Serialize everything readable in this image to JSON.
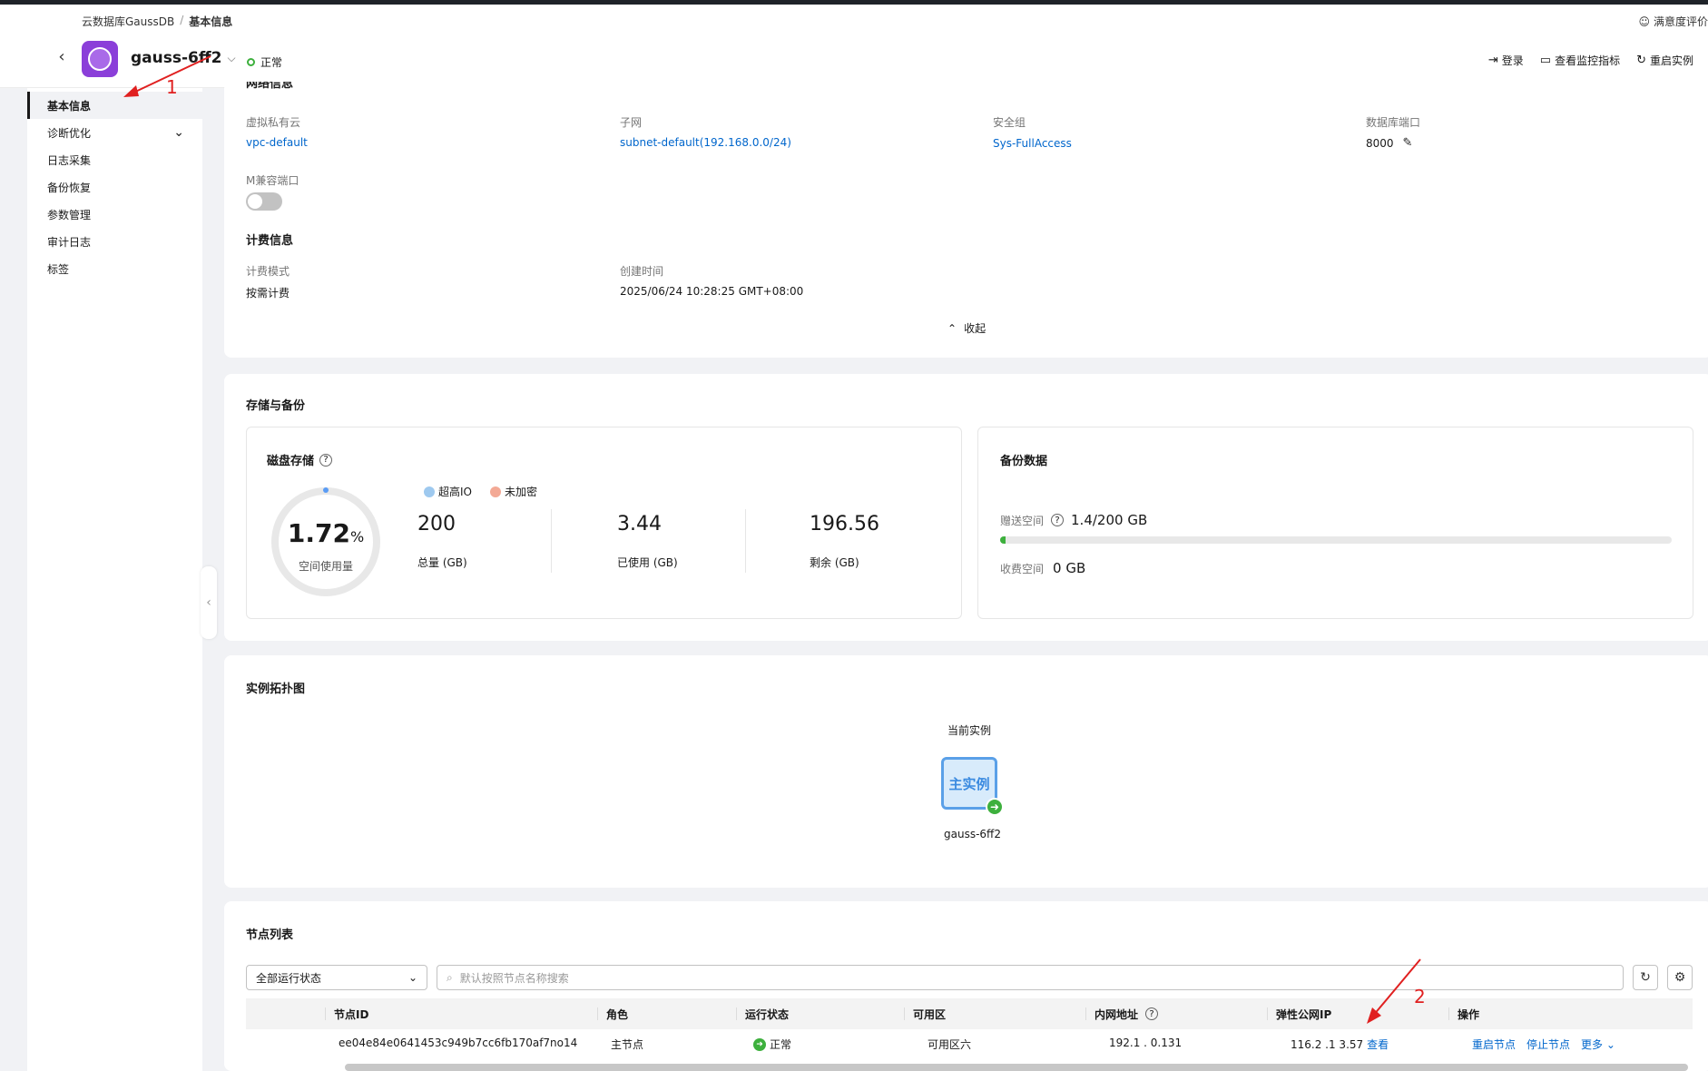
{
  "header": {
    "breadcrumb": [
      "云数据库GaussDB",
      "基本信息"
    ],
    "breadcrumb_sep": "/",
    "feedback": "满意度评价",
    "instance_name": "gauss-6ff2",
    "status": "正常",
    "actions": [
      {
        "label": "登录",
        "icon": "login-icon"
      },
      {
        "label": "查看监控指标",
        "icon": "monitor-icon"
      },
      {
        "label": "重启实例",
        "icon": "restart-icon"
      }
    ]
  },
  "sidebar": {
    "items": [
      {
        "label": "基本信息",
        "active": true
      },
      {
        "label": "诊断优化",
        "expandable": true
      },
      {
        "label": "日志采集"
      },
      {
        "label": "备份恢复"
      },
      {
        "label": "参数管理"
      },
      {
        "label": "审计日志"
      },
      {
        "label": "标签"
      }
    ]
  },
  "network": {
    "title": "网络信息",
    "vpc_label": "虚拟私有云",
    "vpc_value": "vpc-default",
    "subnet_label": "子网",
    "subnet_value": "subnet-default(192.168.0.0/24)",
    "sg_label": "安全组",
    "sg_value": "Sys-FullAccess",
    "port_label": "数据库端口",
    "port_value": "8000",
    "m_compat_label": "M兼容端口",
    "m_compat_enabled": false
  },
  "billing": {
    "title": "计费信息",
    "mode_label": "计费模式",
    "mode_value": "按需计费",
    "created_label": "创建时间",
    "created_value": "2025/06/24 10:28:25 GMT+08:00",
    "collapse": "收起"
  },
  "storage": {
    "title": "存储与备份",
    "disk_title": "磁盘存储",
    "usage_percent": "1.72",
    "usage_unit": "%",
    "usage_label": "空间使用量",
    "usage_fraction": 0.0172,
    "tags": [
      {
        "label": "超高IO",
        "color": "#9ec9ef"
      },
      {
        "label": "未加密",
        "color": "#f3a995"
      }
    ],
    "total_value": "200",
    "total_label": "总量 (GB)",
    "used_value": "3.44",
    "used_label": "已使用 (GB)",
    "remain_value": "196.56",
    "remain_label": "剩余 (GB)",
    "backup_title": "备份数据",
    "free_label": "赠送空间",
    "free_value": "1.4/200 GB",
    "free_fraction": 0.007,
    "paid_label": "收费空间",
    "paid_value": "0 GB"
  },
  "topology": {
    "title": "实例拓扑图",
    "current_label": "当前实例",
    "node_text": "主实例",
    "node_name": "gauss-6ff2"
  },
  "nodes": {
    "title": "节点列表",
    "filter_value": "全部运行状态",
    "search_placeholder": "默认按照节点名称搜索",
    "columns": [
      "节点ID",
      "角色",
      "运行状态",
      "可用区",
      "内网地址",
      "弹性公网IP",
      "操作"
    ],
    "rows": [
      {
        "id": "ee04e84e0641453c949b7cc6fb170af7no14",
        "role": "主节点",
        "status": "正常",
        "az": "可用区六",
        "private_ip": "192.1 . 0.131",
        "eip": "116.2 .1 3.57",
        "eip_link": "查看",
        "ops": [
          "重启节点",
          "停止节点",
          "更多"
        ]
      }
    ]
  },
  "annotations": [
    "1",
    "2"
  ],
  "colors": {
    "accent": "#0066cc",
    "success": "#3db03d",
    "annotation": "#e02020",
    "brand": "#8b3fd9"
  }
}
